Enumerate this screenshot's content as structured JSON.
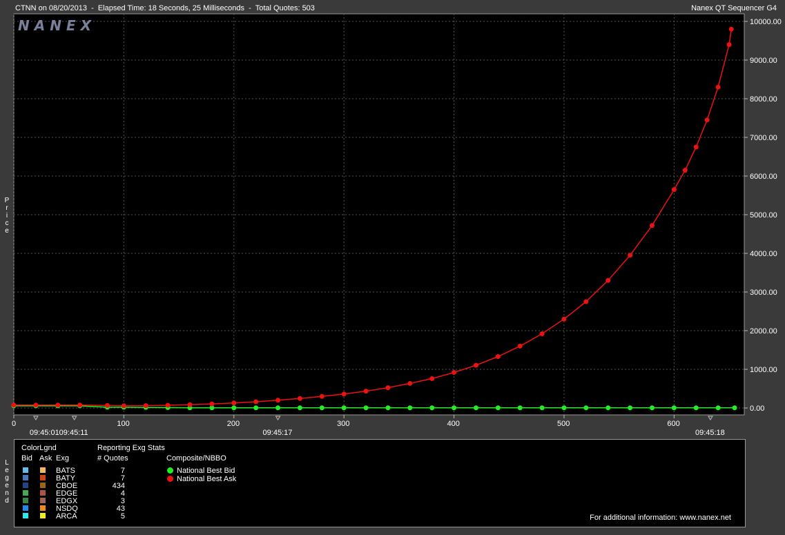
{
  "header": {
    "left_text": "CTNN on 08/20/2013  -  Elapsed Time: 18 Seconds, 25 Milliseconds  -  Total Quotes: 503",
    "right_text": "Nanex QT Sequencer G4"
  },
  "watermark": "NANEX",
  "y_axis_label": "Price",
  "legend_axis_label": "Legend",
  "colors": {
    "bid": "#22ee22",
    "ask": "#ee1111",
    "grid": "#555555",
    "plot_bg": "#000000",
    "frame_bg": "#3a3a3a"
  },
  "chart_data": {
    "type": "scatter",
    "title": "",
    "xlabel": "",
    "ylabel": "Price",
    "xlim": [
      0,
      660
    ],
    "ylim": [
      0,
      10000
    ],
    "x_ticks": [
      0,
      100,
      200,
      300,
      400,
      500,
      600
    ],
    "y_ticks": [
      "0.00",
      "1000.00",
      "2000.00",
      "3000.00",
      "4000.00",
      "5000.00",
      "6000.00",
      "7000.00",
      "8000.00",
      "9000.00",
      "10000.00"
    ],
    "time_labels": [
      {
        "x": 20,
        "label": "09:45:01"
      },
      {
        "x": 55,
        "label": "09:45:11"
      },
      {
        "x": 240,
        "label": "09:45:17"
      },
      {
        "x": 633,
        "label": "09:45:18"
      }
    ],
    "grid": true,
    "series": [
      {
        "name": "National Best Bid",
        "color": "#22ee22",
        "x": [
          0,
          20,
          40,
          60,
          85,
          100,
          120,
          140,
          160,
          180,
          200,
          220,
          240,
          260,
          280,
          300,
          320,
          340,
          360,
          380,
          400,
          420,
          440,
          460,
          480,
          500,
          520,
          540,
          560,
          580,
          600,
          620,
          640,
          655
        ],
        "y": [
          55,
          55,
          55,
          55,
          20,
          20,
          15,
          10,
          5,
          5,
          5,
          5,
          5,
          5,
          5,
          5,
          5,
          5,
          5,
          5,
          5,
          5,
          5,
          5,
          5,
          5,
          5,
          5,
          5,
          5,
          5,
          5,
          5,
          5
        ]
      },
      {
        "name": "National Best Ask",
        "color": "#ee1111",
        "x": [
          0,
          20,
          40,
          60,
          85,
          100,
          120,
          140,
          160,
          180,
          200,
          220,
          240,
          260,
          280,
          300,
          320,
          340,
          360,
          380,
          400,
          420,
          440,
          460,
          480,
          500,
          520,
          540,
          560,
          580,
          600,
          610,
          620,
          630,
          640,
          650,
          652
        ],
        "y": [
          75,
          75,
          75,
          75,
          65,
          55,
          60,
          70,
          85,
          105,
          130,
          160,
          200,
          245,
          300,
          360,
          435,
          525,
          635,
          760,
          920,
          1105,
          1330,
          1600,
          1920,
          2300,
          2750,
          3300,
          3950,
          4720,
          5650,
          6150,
          6750,
          7450,
          8300,
          9400,
          9800
        ]
      }
    ]
  },
  "legend": {
    "color_header": "ColorLgnd",
    "bid_header": "Bid",
    "ask_header": "Ask",
    "exg_header": "Exg",
    "stats_header": "Reporting Exg Stats",
    "quotes_header": "# Quotes",
    "composite_header": "Composite/NBBO",
    "exchanges": [
      {
        "name": "BATS",
        "quotes": "7",
        "bid_color": "#66bbee",
        "ask_color": "#f0b866"
      },
      {
        "name": "BATY",
        "quotes": "7",
        "bid_color": "#4477bb",
        "ask_color": "#cc4411"
      },
      {
        "name": "CBOE",
        "quotes": "434",
        "bid_color": "#224488",
        "ask_color": "#996611"
      },
      {
        "name": "EDGE",
        "quotes": "4",
        "bid_color": "#44aa55",
        "ask_color": "#aa5544"
      },
      {
        "name": "EDGX",
        "quotes": "3",
        "bid_color": "#338844",
        "ask_color": "#996655"
      },
      {
        "name": "NSDQ",
        "quotes": "43",
        "bid_color": "#2288ee",
        "ask_color": "#ee8822"
      },
      {
        "name": "ARCA",
        "quotes": "5",
        "bid_color": "#22eeee",
        "ask_color": "#eeee22"
      }
    ],
    "nbbo": [
      {
        "label": "National Best Bid",
        "color": "#22ee22"
      },
      {
        "label": "National Best Ask",
        "color": "#ee1111"
      }
    ],
    "footer": "For additional information: www.nanex.net"
  }
}
